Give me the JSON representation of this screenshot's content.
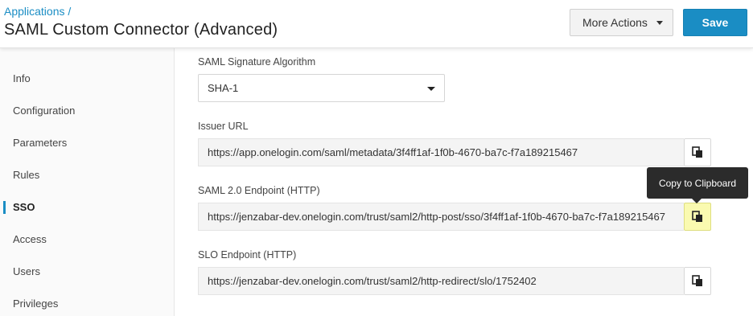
{
  "header": {
    "breadcrumb": "Applications /",
    "title": "SAML Custom Connector (Advanced)",
    "more_actions_label": "More Actions",
    "save_label": "Save"
  },
  "sidebar": {
    "items": [
      {
        "label": "Info"
      },
      {
        "label": "Configuration"
      },
      {
        "label": "Parameters"
      },
      {
        "label": "Rules"
      },
      {
        "label": "SSO"
      },
      {
        "label": "Access"
      },
      {
        "label": "Users"
      },
      {
        "label": "Privileges"
      }
    ],
    "active": "SSO"
  },
  "main": {
    "signature_algorithm": {
      "label": "SAML Signature Algorithm",
      "value": "SHA-1"
    },
    "issuer_url": {
      "label": "Issuer URL",
      "value": "https://app.onelogin.com/saml/metadata/3f4ff1af-1f0b-4670-ba7c-f7a189215467"
    },
    "saml_endpoint": {
      "label": "SAML 2.0 Endpoint (HTTP)",
      "value": "https://jenzabar-dev.onelogin.com/trust/saml2/http-post/sso/3f4ff1af-1f0b-4670-ba7c-f7a189215467"
    },
    "slo_endpoint": {
      "label": "SLO Endpoint (HTTP)",
      "value": "https://jenzabar-dev.onelogin.com/trust/saml2/http-redirect/slo/1752402"
    },
    "tooltip": "Copy to Clipboard"
  },
  "icons": {
    "copy": "clipboard-icon",
    "more_actions_caret": "caret-down-icon",
    "select_caret": "caret-down-icon"
  },
  "colors": {
    "accent": "#1a8dc4",
    "copy_hover": "#fafab0",
    "tooltip_bg": "#2b2b2b"
  }
}
